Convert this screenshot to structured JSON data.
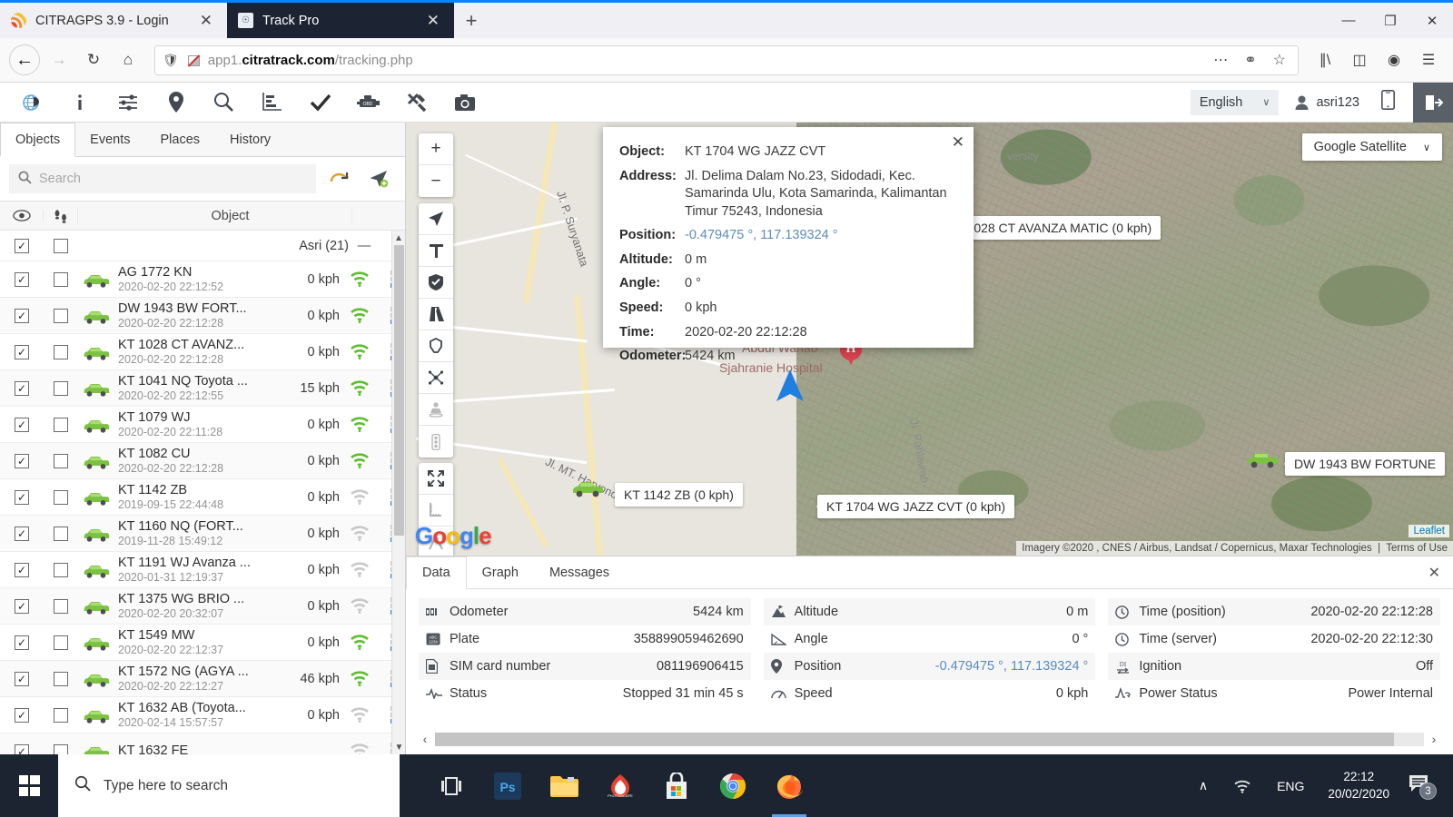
{
  "browser": {
    "tabs": [
      {
        "title": "CITRAGPS 3.9 - Login",
        "active": false,
        "favicon": "citragps-rss-icon"
      },
      {
        "title": "Track Pro",
        "active": true,
        "favicon": "track-pro-icon"
      }
    ],
    "newtab_label": "+",
    "window_controls": {
      "minimize": "—",
      "maximize": "❐",
      "close": "✕"
    },
    "nav": {
      "back": "←",
      "forward": "→",
      "reload": "↻",
      "home": "⌂"
    },
    "url": {
      "scheme": "",
      "host": "app1.",
      "domain": "citratrack.com",
      "path": "/tracking.php"
    },
    "url_icons": [
      "more-dots-icon",
      "pocket-icon",
      "bookmark-star-icon"
    ],
    "toolbar_icons": [
      "library-icon",
      "sidebar-icon",
      "account-icon",
      "hamburger-menu-icon"
    ]
  },
  "appbar": {
    "icons": [
      "globe-logo-icon",
      "info-icon",
      "settings-sliders-icon",
      "map-marker-icon",
      "search-zoom-icon",
      "reports-chart-icon",
      "check-icon",
      "engine-icon",
      "tools-icon",
      "camera-icon"
    ],
    "language": "English",
    "language_chevron": "∨",
    "user": "asri123",
    "mobile_icon": "mobile-phone-icon",
    "logout_icon": "logout-icon"
  },
  "sidebar": {
    "tabs": [
      {
        "label": "Objects",
        "active": true
      },
      {
        "label": "Events",
        "active": false
      },
      {
        "label": "Places",
        "active": false
      },
      {
        "label": "History",
        "active": false
      }
    ],
    "search_placeholder": "Search",
    "search_value": "",
    "buttons": [
      "refresh-icon",
      "add-object-icon"
    ],
    "columns": {
      "eye": "eye-icon",
      "footsteps": "footsteps-icon",
      "object": "Object"
    },
    "group": {
      "label": "Asri (21)",
      "collapse": "—"
    },
    "objects": [
      {
        "name": "AG 1772 KN",
        "time": "2020-02-20 22:12:52",
        "speed": "0 kph",
        "signal": "strong"
      },
      {
        "name": "DW 1943 BW FORT...",
        "time": "2020-02-20 22:12:28",
        "speed": "0 kph",
        "signal": "strong"
      },
      {
        "name": "KT 1028 CT AVANZ...",
        "time": "2020-02-20 22:12:28",
        "speed": "0 kph",
        "signal": "strong"
      },
      {
        "name": "KT 1041 NQ Toyota ...",
        "time": "2020-02-20 22:12:55",
        "speed": "15 kph",
        "signal": "strong"
      },
      {
        "name": "KT 1079 WJ",
        "time": "2020-02-20 22:11:28",
        "speed": "0 kph",
        "signal": "strong"
      },
      {
        "name": "KT 1082 CU",
        "time": "2020-02-20 22:12:28",
        "speed": "0 kph",
        "signal": "strong"
      },
      {
        "name": "KT 1142 ZB",
        "time": "2019-09-15 22:44:48",
        "speed": "0 kph",
        "signal": "weak"
      },
      {
        "name": "KT 1160 NQ (FORT...",
        "time": "2019-11-28 15:49:12",
        "speed": "0 kph",
        "signal": "weak"
      },
      {
        "name": "KT 1191 WJ Avanza ...",
        "time": "2020-01-31 12:19:37",
        "speed": "0 kph",
        "signal": "weak"
      },
      {
        "name": "KT 1375 WG BRIO ...",
        "time": "2020-02-20 20:32:07",
        "speed": "0 kph",
        "signal": "weak"
      },
      {
        "name": "KT 1549 MW",
        "time": "2020-02-20 22:12:37",
        "speed": "0 kph",
        "signal": "strong"
      },
      {
        "name": "KT 1572 NG (AGYA ...",
        "time": "2020-02-20 22:12:27",
        "speed": "46 kph",
        "signal": "strong"
      },
      {
        "name": "KT 1632 AB (Toyota...",
        "time": "2020-02-14 15:57:57",
        "speed": "0 kph",
        "signal": "weak"
      },
      {
        "name": "KT 1632 FE",
        "time": "",
        "speed": "",
        "signal": "weak"
      }
    ]
  },
  "map": {
    "layer_button": "Google Satellite",
    "layer_chevron": "∨",
    "zoom_in": "+",
    "zoom_out": "−",
    "tool_icons": [
      "navigate-arrow-icon",
      "text-label-icon",
      "shield-check-icon",
      "road-icon",
      "polygon-icon",
      "cluster-icon",
      "poi-icon",
      "traffic-light-icon"
    ],
    "bottom_tool_icons": [
      "fullscreen-icon",
      "ruler-icon",
      "measure-angle-icon"
    ],
    "road_labels": [
      "Jl. P. Suryanata",
      "Jl. MT. Haryono",
      "Jl. Pahlawan"
    ],
    "poi_labels": [
      "Abdul Wahab",
      "Sjahranie Hospital",
      "versity"
    ],
    "vehicle_labels": [
      "KT 1028 CT AVANZA MATIC (0 kph)",
      "KT 1142 ZB (0 kph)",
      "KT 1704 WG JAZZ CVT (0 kph)",
      "DW 1943 BW FORTUNE"
    ],
    "google_watermark": "Google",
    "attribution": "Imagery ©2020 , CNES / Airbus, Landsat / Copernicus, Maxar Technologies",
    "terms": "Terms of Use",
    "leaflet": "Leaflet"
  },
  "popup": {
    "close": "✕",
    "rows": [
      {
        "label": "Object:",
        "value": "KT 1704 WG JAZZ CVT",
        "link": false
      },
      {
        "label": "Address:",
        "value": "Jl. Delima Dalam No.23, Sidodadi, Kec. Samarinda Ulu, Kota Samarinda, Kalimantan Timur 75243, Indonesia",
        "link": false
      },
      {
        "label": "Position:",
        "value": "-0.479475 °, 117.139324 °",
        "link": true
      },
      {
        "label": "Altitude:",
        "value": "0 m",
        "link": false
      },
      {
        "label": "Angle:",
        "value": "0 °",
        "link": false
      },
      {
        "label": "Speed:",
        "value": "0 kph",
        "link": false
      },
      {
        "label": "Time:",
        "value": "2020-02-20 22:12:28",
        "link": false
      },
      {
        "label": "Odometer:",
        "value": "5424 km",
        "link": false
      }
    ]
  },
  "datapanel": {
    "tabs": [
      {
        "label": "Data",
        "active": true
      },
      {
        "label": "Graph",
        "active": false
      },
      {
        "label": "Messages",
        "active": false
      }
    ],
    "close": "✕",
    "columns": [
      [
        {
          "icon": "odometer-icon",
          "name": "Odometer",
          "value": "5424 km",
          "link": false
        },
        {
          "icon": "plate-icon",
          "name": "Plate",
          "value": "358899059462690",
          "link": false
        },
        {
          "icon": "sim-card-icon",
          "name": "SIM card number",
          "value": "081196906415",
          "link": false
        },
        {
          "icon": "status-pulse-icon",
          "name": "Status",
          "value": "Stopped 31 min 45 s",
          "link": false
        }
      ],
      [
        {
          "icon": "altitude-mountain-icon",
          "name": "Altitude",
          "value": "0 m",
          "link": false
        },
        {
          "icon": "angle-icon",
          "name": "Angle",
          "value": "0 °",
          "link": false
        },
        {
          "icon": "position-marker-icon",
          "name": "Position",
          "value": "-0.479475 °, 117.139324 °",
          "link": true
        },
        {
          "icon": "speedometer-icon",
          "name": "Speed",
          "value": "0 kph",
          "link": false
        }
      ],
      [
        {
          "icon": "clock-icon",
          "name": "Time (position)",
          "value": "2020-02-20 22:12:28",
          "link": false
        },
        {
          "icon": "clock-icon",
          "name": "Time (server)",
          "value": "2020-02-20 22:12:30",
          "link": false
        },
        {
          "icon": "digital-input-icon",
          "name": "Ignition",
          "value": "Off",
          "link": false
        },
        {
          "icon": "power-status-icon",
          "name": "Power Status",
          "value": "Power Internal",
          "link": false
        }
      ]
    ],
    "scroll_left": "‹",
    "scroll_right": "›"
  },
  "taskbar": {
    "start_icon": "windows-start-icon",
    "search_placeholder": "Type here to search",
    "apps": [
      "task-view-icon",
      "photoshop-icon",
      "file-explorer-icon",
      "photoscape-icon",
      "microsoft-store-icon",
      "chrome-icon",
      "firefox-icon"
    ],
    "tray": {
      "chevron": "∧",
      "network_icon": "wifi-icon",
      "language": "ENG",
      "time": "22:12",
      "date": "20/02/2020",
      "notification_icon": "notifications-icon",
      "notification_count": "3"
    }
  },
  "colors": {
    "accent_blue": "#0a84ff",
    "active_tab_bg": "#1c2433",
    "vehicle_green": "#7cc242",
    "link_blue": "#5b8bbd",
    "taskbar_bg": "#1b2430",
    "signal_green": "#5bbf2e",
    "signal_grey": "#c8c8c8",
    "hospital_red": "#d9434f"
  }
}
